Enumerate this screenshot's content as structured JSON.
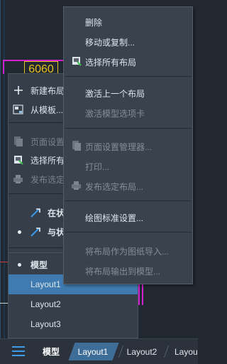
{
  "canvas": {
    "label": "6060"
  },
  "left_menu": {
    "items": [
      {
        "label": "新建布局",
        "icon": "plus-icon",
        "disabled": false
      },
      {
        "label": "从模板...",
        "icon": "template-icon",
        "disabled": false
      },
      {
        "label": "页面设置",
        "icon": "page-setup-icon",
        "disabled": true
      },
      {
        "label": "选择所有",
        "icon": "select-all-icon",
        "disabled": false
      },
      {
        "label": "发布选定",
        "icon": "publish-icon",
        "disabled": true
      },
      {
        "label": "在状",
        "icon": "statusbar-icon",
        "disabled": false
      },
      {
        "label": "与状",
        "icon": "toolbar-icon",
        "disabled": false
      }
    ]
  },
  "list": {
    "items": [
      {
        "label": "模型"
      },
      {
        "label": "Layout1"
      },
      {
        "label": "Layout2"
      },
      {
        "label": "Layout3"
      }
    ]
  },
  "context_menu": {
    "items": [
      {
        "label": "删除",
        "disabled": false,
        "icon": ""
      },
      {
        "label": "移动或复制...",
        "disabled": false,
        "icon": ""
      },
      {
        "label": "选择所有布局",
        "disabled": false,
        "icon": "select-layouts-icon"
      },
      {
        "label": "激活上一个布局",
        "disabled": false,
        "icon": ""
      },
      {
        "label": "激活模型选项卡",
        "disabled": true,
        "icon": ""
      },
      {
        "label": "页面设置管理器...",
        "disabled": true,
        "icon": "page-setup-icon"
      },
      {
        "label": "打印...",
        "disabled": true,
        "icon": ""
      },
      {
        "label": "发布选定布局...",
        "disabled": true,
        "icon": "publish-icon"
      },
      {
        "label": "绘图标准设置...",
        "disabled": false,
        "icon": ""
      },
      {
        "label": "将布局作为图纸导入...",
        "disabled": true,
        "icon": ""
      },
      {
        "label": "将布局输出到模型...",
        "disabled": true,
        "icon": ""
      }
    ]
  },
  "tabbar": {
    "tabs": [
      "模型",
      "Layout1",
      "Layout2",
      "Layou"
    ]
  },
  "colors": {
    "accent": "#3f7bb0",
    "menu_bg": "#3a424d",
    "disabled_text": "#848d97",
    "cad_magenta": "#d020d0",
    "cad_yellow": "#e6c21e"
  }
}
